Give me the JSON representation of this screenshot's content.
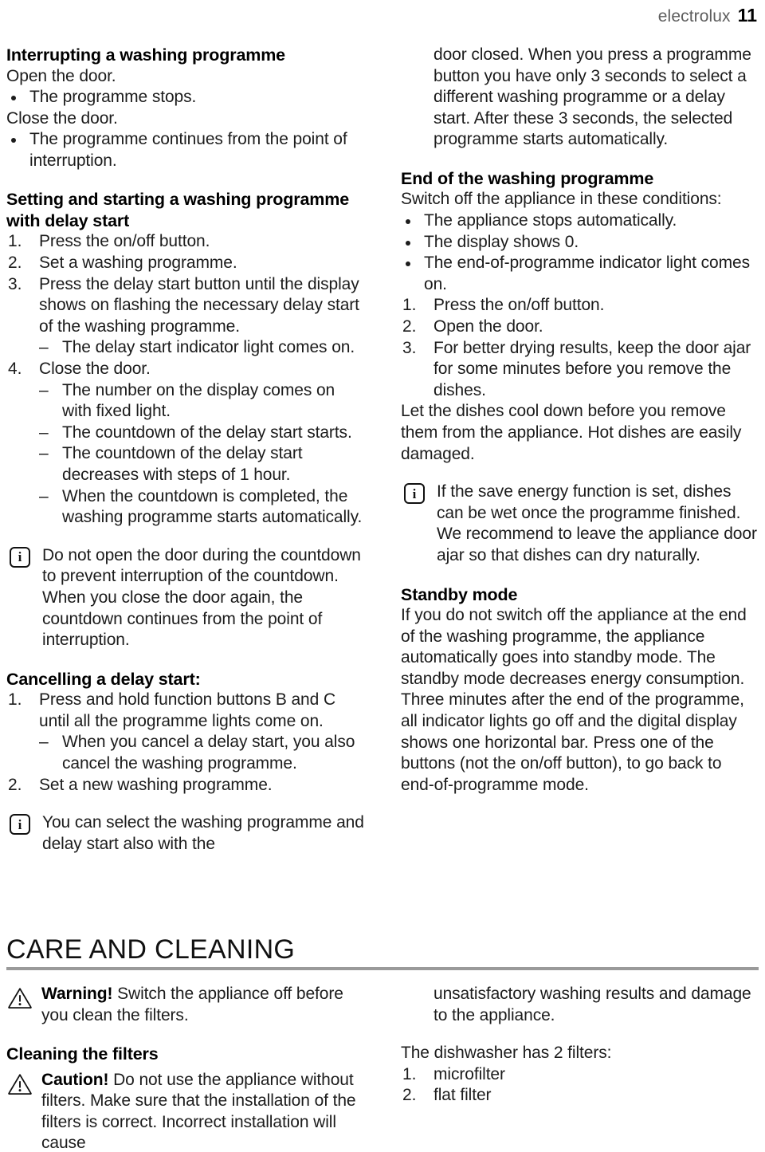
{
  "header": {
    "brand": "electrolux",
    "page_number": "11"
  },
  "left_column": {
    "heading_interrupting": "Interrupting a washing programme",
    "open_door_line": "Open the door.",
    "bullets_open": [
      "The programme stops."
    ],
    "close_door_line": "Close the door.",
    "bullets_close": [
      "The programme continues from the point of interruption."
    ],
    "heading_setting": "Setting and starting a washing programme with delay start",
    "steps": [
      {
        "num": "1.",
        "text": "Press the on/off button."
      },
      {
        "num": "2.",
        "text": "Set a washing programme."
      },
      {
        "num": "3.",
        "text": "Press the delay start button until the display shows on flashing the necessary delay start of the washing programme."
      },
      {
        "num": "4.",
        "text": "Close the door."
      }
    ],
    "sub_after_step3": [
      "The delay start indicator light comes on."
    ],
    "sub_after_step4": [
      "The number on the display comes on with fixed light.",
      "The countdown of the delay start starts.",
      "The countdown of the delay start decreases with steps of 1 hour.",
      "When the countdown is completed, the washing programme starts automatically."
    ],
    "note_countdown": {
      "icon": "info-icon",
      "icon_glyph": "i",
      "text": "Do not open the door during the countdown to prevent interruption of the countdown. When you close the door again, the countdown continues from the point of interruption."
    },
    "heading_cancelling": "Cancelling a delay start:",
    "cancel_steps": [
      {
        "num": "1.",
        "text": "Press and hold function buttons B and C until all the programme lights come on."
      },
      {
        "num": "2.",
        "text": "Set a new washing programme."
      }
    ],
    "cancel_sub_after_step1": [
      "When you cancel a delay start, you also cancel the washing programme."
    ],
    "note_select": {
      "icon": "info-icon",
      "icon_glyph": "i",
      "text": "You can select the washing programme and delay start also with the"
    }
  },
  "right_column": {
    "continuation_text": "door closed. When you press a programme button you have only 3 seconds to select a different washing programme or a delay start. After these 3 seconds, the selected programme starts automatically.",
    "heading_end": "End of the washing programme",
    "switch_off_intro": "Switch off the appliance in these conditions:",
    "end_bullets": [
      "The appliance stops automatically.",
      "The display shows 0.",
      "The end-of-programme indicator light comes on."
    ],
    "end_steps": [
      {
        "num": "1.",
        "text": "Press the on/off button."
      },
      {
        "num": "2.",
        "text": "Open the door."
      },
      {
        "num": "3.",
        "text": "For better drying results, keep the door ajar for some minutes before you remove the dishes."
      }
    ],
    "cool_down_para": "Let the dishes cool down before you remove them from the appliance. Hot dishes are easily damaged.",
    "note_save_energy": {
      "icon": "info-icon",
      "icon_glyph": "i",
      "text": "If the save energy function is set, dishes can be wet once the programme finished. We recommend to leave the appliance door ajar so that dishes can dry naturally."
    },
    "heading_standby": "Standby mode",
    "standby_para_1": "If you do not switch off the appliance at the end of the washing programme, the appliance automatically goes into standby mode. The standby mode decreases energy consumption.",
    "standby_para_2": "Three minutes after the end of the programme, all indicator lights go off and the digital display shows one horizontal bar. Press one of the buttons (not the on/off button), to go back to end-of-programme mode."
  },
  "chapter": {
    "title": "CARE AND CLEANING"
  },
  "bottom_left": {
    "note_warning": {
      "icon": "warning-triangle-icon",
      "label": "Warning!",
      "text": " Switch the appliance off before you clean the filters."
    },
    "heading_cleaning": "Cleaning the filters",
    "note_caution": {
      "icon": "warning-triangle-icon",
      "label": "Caution!",
      "text": " Do not use the appliance without filters. Make sure that the installation of the filters is correct. Incorrect installation will cause"
    }
  },
  "bottom_right": {
    "continuation_text": "unsatisfactory washing results and damage to the appliance.",
    "filters_intro": "The dishwasher has 2 filters:",
    "filters": [
      {
        "num": "1.",
        "text": "microfilter"
      },
      {
        "num": "2.",
        "text": "flat filter"
      }
    ]
  },
  "colors": {
    "text": "#1c1c1c",
    "brand": "#5d5d5d",
    "rule": "#9a9a9a"
  }
}
